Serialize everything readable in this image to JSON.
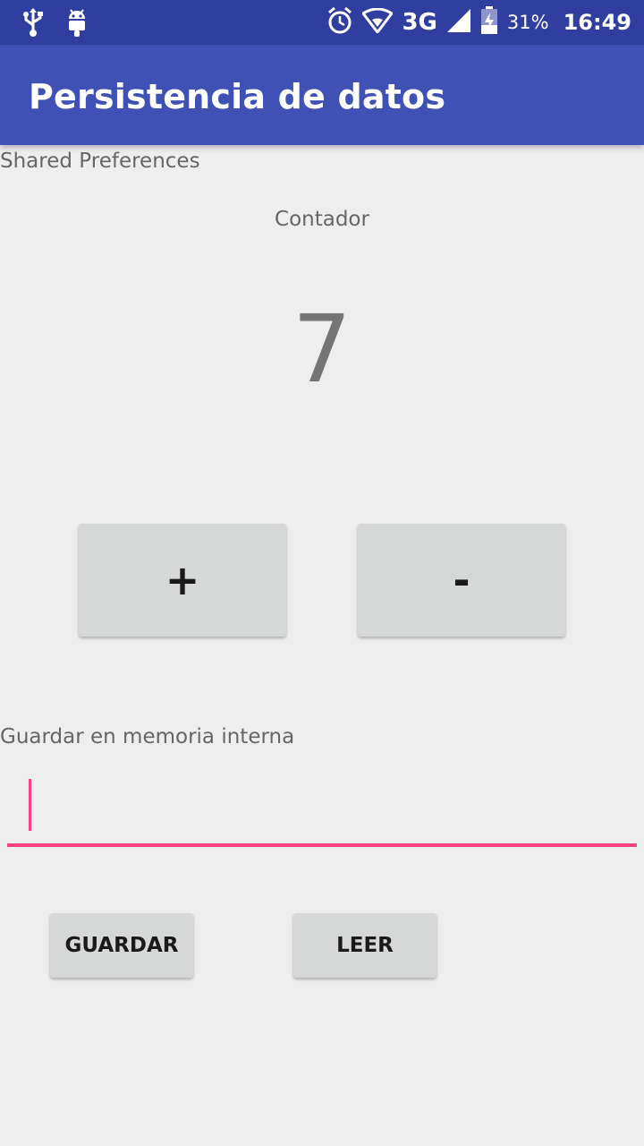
{
  "status_bar": {
    "icons_left": [
      "usb-icon",
      "android-debug-icon"
    ],
    "icons_right": [
      "alarm-icon",
      "wifi-icon",
      "signal-icon",
      "battery-charging-icon"
    ],
    "network": "3G",
    "battery_percent": "31%",
    "time": "16:49"
  },
  "app_bar": {
    "title": "Persistencia de datos"
  },
  "shared_prefs": {
    "section_label": "Shared Preferences",
    "counter_caption": "Contador",
    "counter_value": "7",
    "increment_label": "+",
    "decrement_label": "-"
  },
  "internal_storage": {
    "section_label": "Guardar en memoria interna",
    "input_value": "",
    "input_placeholder": "",
    "save_label": "GUARDAR",
    "read_label": "LEER"
  },
  "colors": {
    "status_bar": "#303f9f",
    "app_bar": "#3f51b5",
    "accent": "#ff4081",
    "background": "#eeeeee",
    "button": "#d6d7d7"
  }
}
